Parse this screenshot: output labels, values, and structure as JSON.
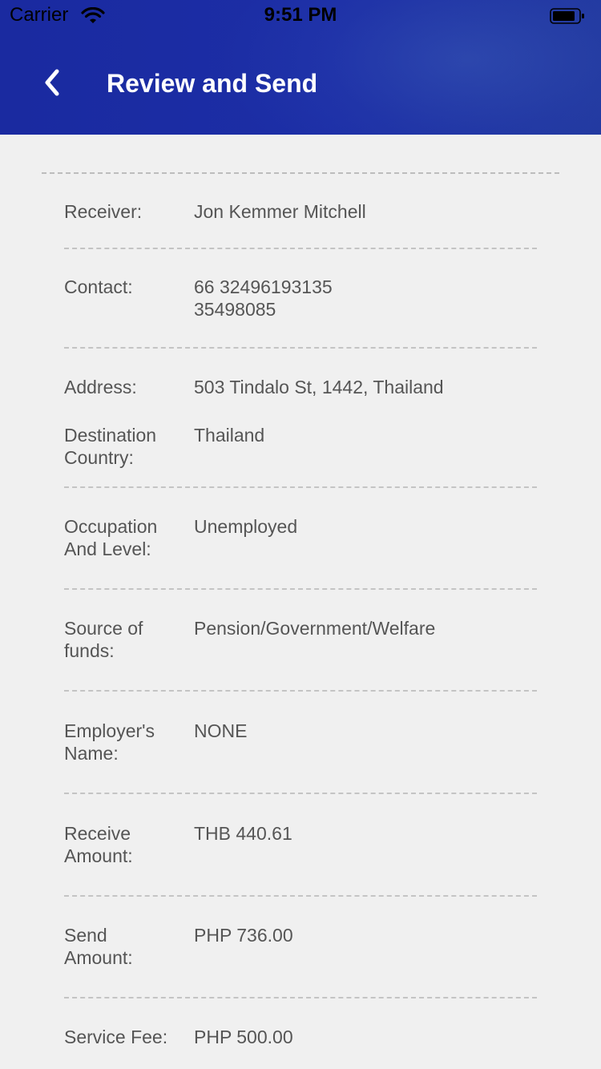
{
  "status_bar": {
    "carrier": "Carrier",
    "time": "9:51 PM"
  },
  "header": {
    "title": "Review and Send",
    "back_icon": "chevron-left-icon"
  },
  "colors": {
    "header_blue": "#1c2ea6",
    "background": "#f0f0f0",
    "text": "#555555"
  },
  "details": {
    "receiver": {
      "label": "Receiver:",
      "value": "Jon Kemmer Mitchell"
    },
    "contact": {
      "label": "Contact:",
      "value_line1": "66 32496193135",
      "value_line2": "35498085"
    },
    "address": {
      "label": "Address:",
      "value": "503 Tindalo St, 1442, Thailand"
    },
    "destination": {
      "label_line1": "Destination",
      "label_line2": "Country:",
      "value": "Thailand"
    },
    "occupation": {
      "label_line1": "Occupation",
      "label_line2": "And Level:",
      "value": "Unemployed"
    },
    "source": {
      "label_line1": "Source of",
      "label_line2": "funds:",
      "value": "Pension/Government/Welfare"
    },
    "employer": {
      "label_line1": "Employer's",
      "label_line2": "Name:",
      "value": "NONE"
    },
    "receive_amount": {
      "label_line1": "Receive",
      "label_line2": "Amount:",
      "value": "THB 440.61"
    },
    "send_amount": {
      "label_line1": "Send",
      "label_line2": "Amount:",
      "value": "PHP 736.00"
    },
    "service_fee": {
      "label": "Service Fee:",
      "value": "PHP 500.00"
    }
  }
}
